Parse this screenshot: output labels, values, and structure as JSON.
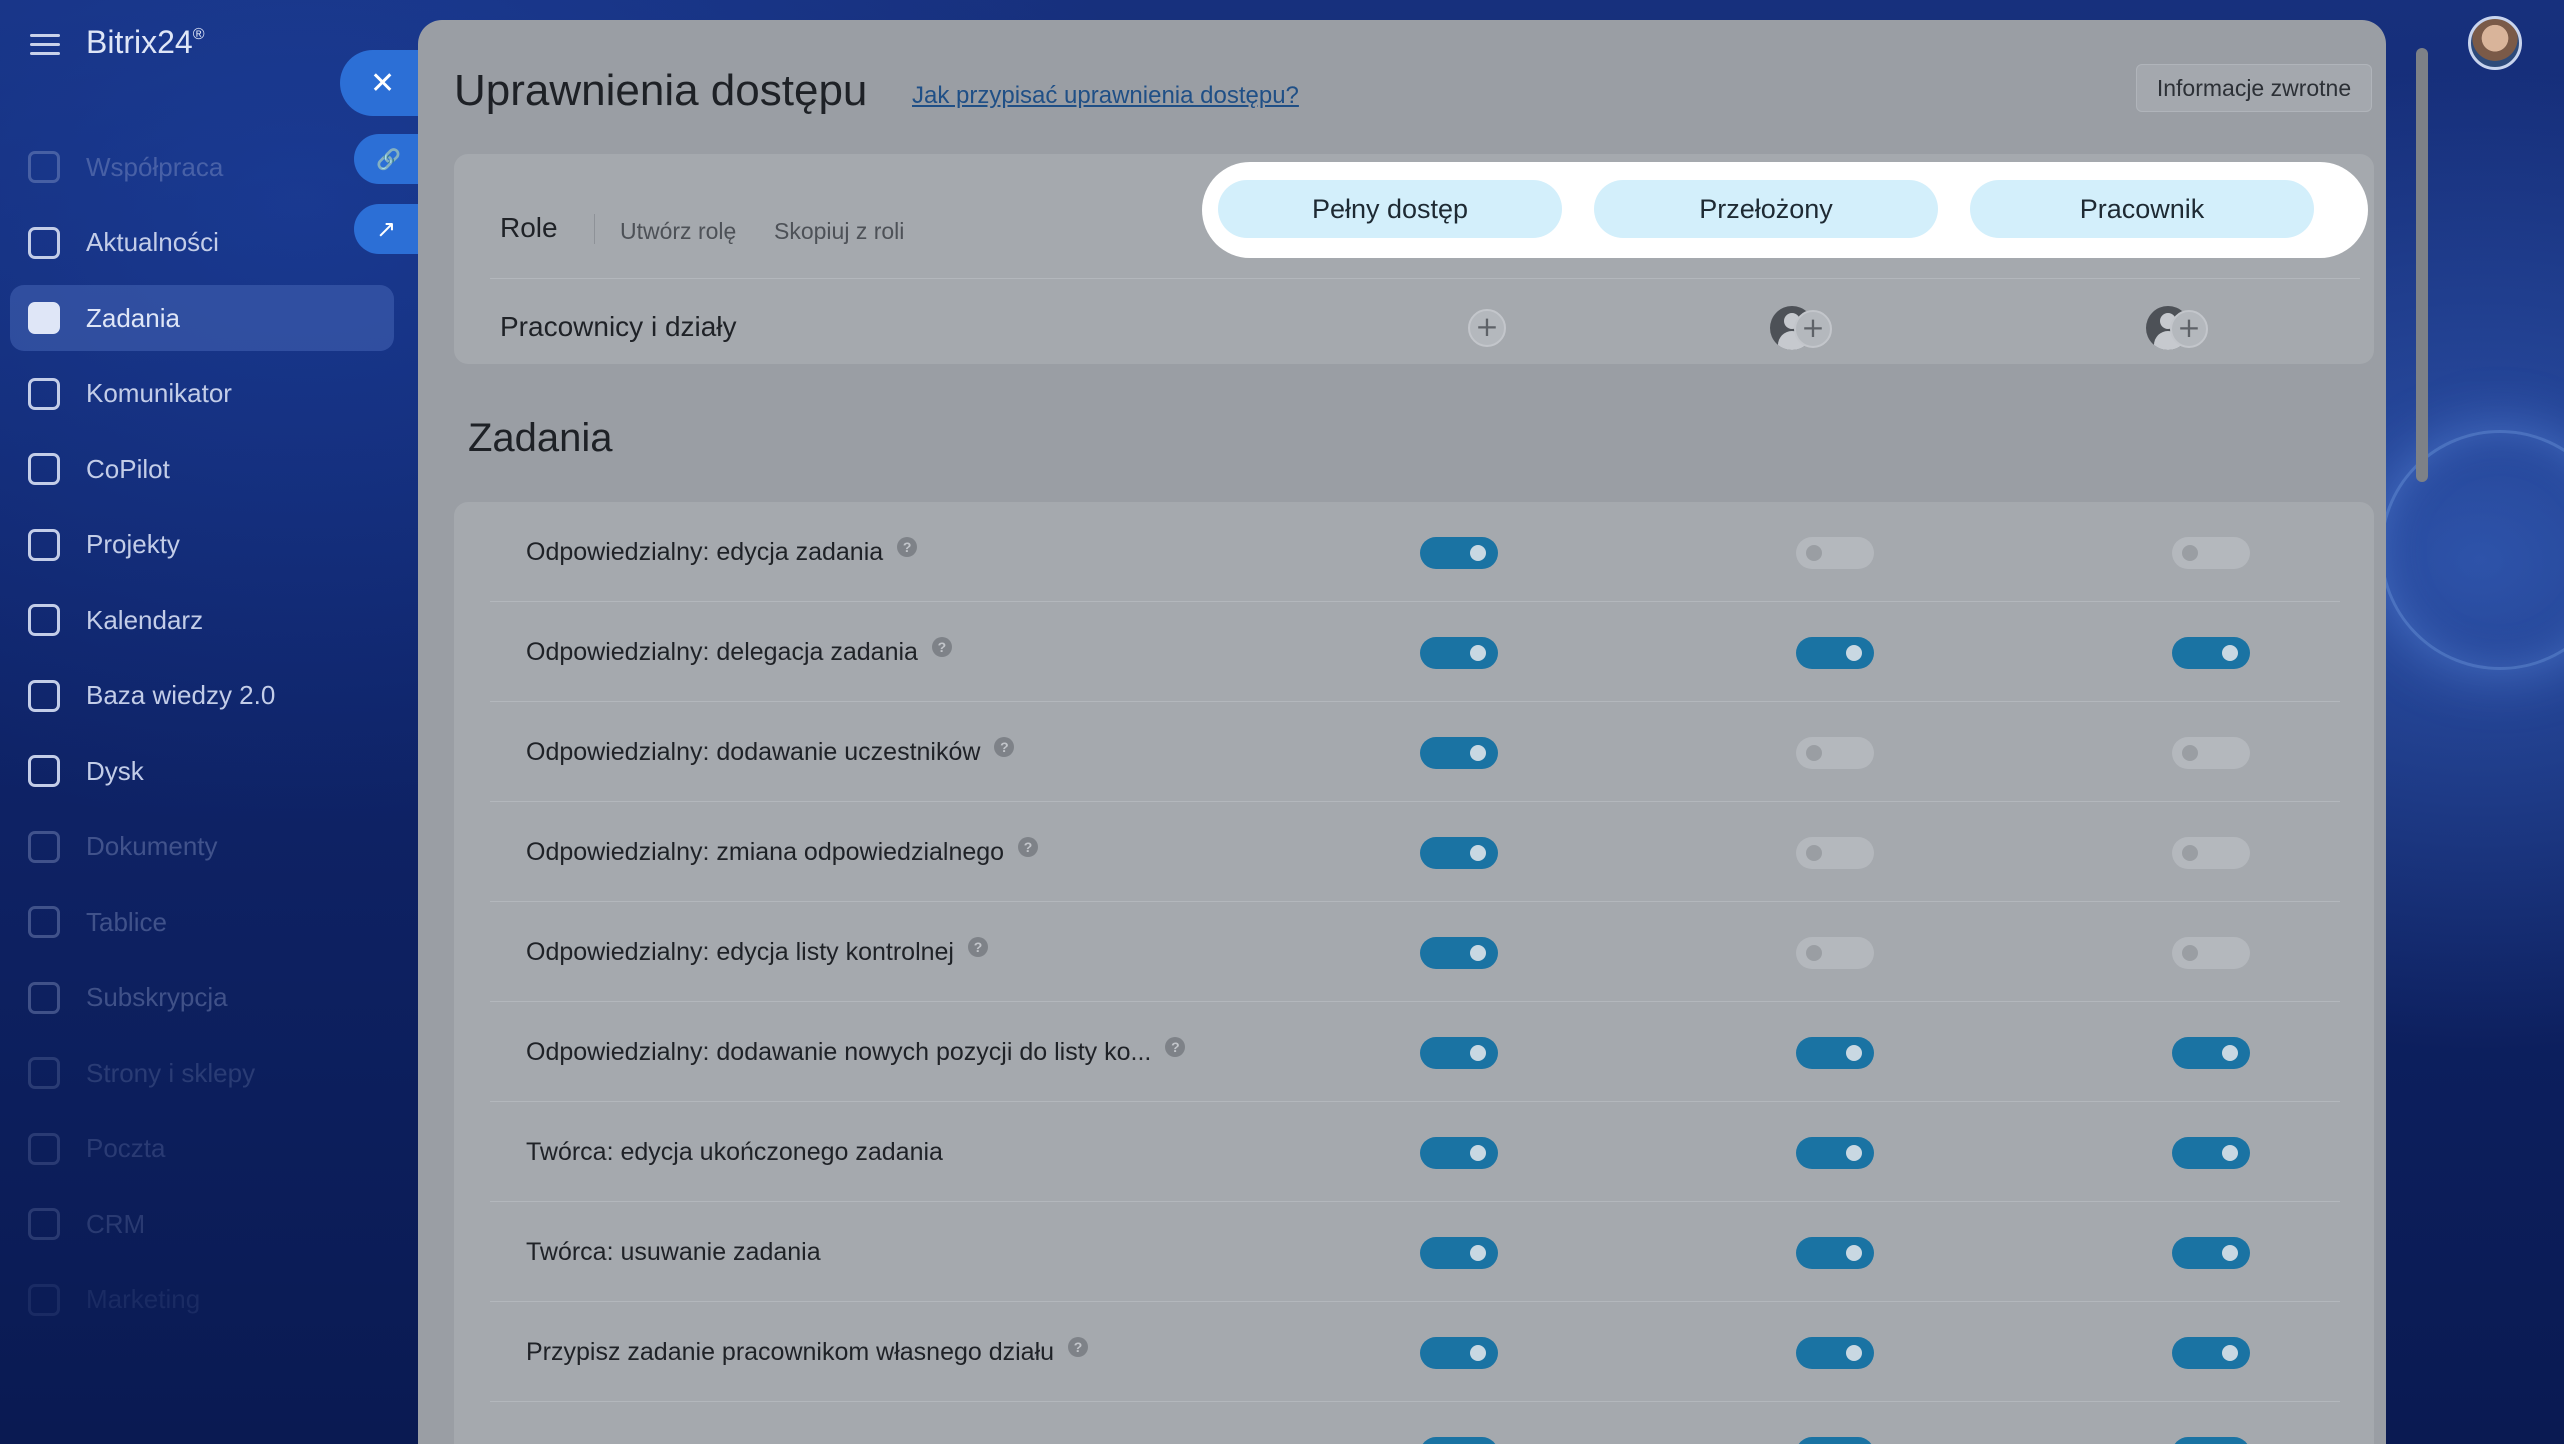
{
  "app": {
    "brand": "Bitrix24",
    "brand_mark": "®"
  },
  "sidebar": {
    "items": [
      {
        "label": "Współpraca",
        "icon": "collaboration-icon",
        "state": "dim"
      },
      {
        "label": "Aktualności",
        "icon": "news-icon",
        "state": "bright"
      },
      {
        "label": "Zadania",
        "icon": "tasks-icon",
        "state": "active"
      },
      {
        "label": "Komunikator",
        "icon": "chat-icon",
        "state": "bright"
      },
      {
        "label": "CoPilot",
        "icon": "copilot-icon",
        "state": "bright"
      },
      {
        "label": "Projekty",
        "icon": "projects-icon",
        "state": "bright"
      },
      {
        "label": "Kalendarz",
        "icon": "calendar-icon",
        "state": "bright"
      },
      {
        "label": "Baza wiedzy 2.0",
        "icon": "knowledge-base-icon",
        "state": "bright"
      },
      {
        "label": "Dysk",
        "icon": "drive-icon",
        "state": "bright"
      },
      {
        "label": "Dokumenty",
        "icon": "documents-icon",
        "state": "dim"
      },
      {
        "label": "Tablice",
        "icon": "boards-icon",
        "state": "dim"
      },
      {
        "label": "Subskrypcja",
        "icon": "subscription-icon",
        "state": "dim"
      },
      {
        "label": "Strony i sklepy",
        "icon": "sites-icon",
        "state": "dimmer"
      },
      {
        "label": "Poczta",
        "icon": "mail-icon",
        "state": "dimmer"
      },
      {
        "label": "CRM",
        "icon": "crm-icon",
        "state": "dimmer"
      },
      {
        "label": "Marketing",
        "icon": "marketing-icon",
        "state": "dimmest"
      }
    ]
  },
  "side_actions": {
    "close": "✕",
    "link": "🔗",
    "open_external": "↗"
  },
  "panel": {
    "title": "Uprawnienia dostępu",
    "help_link": "Jak przypisać uprawnienia dostępu?",
    "feedback": "Informacje zwrotne"
  },
  "roles": {
    "label": "Role",
    "create": "Utwórz rolę",
    "copy": "Skopiuj z roli",
    "columns": [
      "Pełny dostęp",
      "Przełożony",
      "Pracownik"
    ],
    "staff_label": "Pracownicy i działy",
    "add_symbol": "+"
  },
  "section": {
    "title": "Zadania"
  },
  "permissions": [
    {
      "label": "Odpowiedzialny: edycja zadania",
      "help": true,
      "values": [
        true,
        false,
        false
      ]
    },
    {
      "label": "Odpowiedzialny: delegacja zadania",
      "help": true,
      "values": [
        true,
        true,
        true
      ]
    },
    {
      "label": "Odpowiedzialny: dodawanie uczestników",
      "help": true,
      "values": [
        true,
        false,
        false
      ]
    },
    {
      "label": "Odpowiedzialny: zmiana odpowiedzialnego",
      "help": true,
      "values": [
        true,
        false,
        false
      ]
    },
    {
      "label": "Odpowiedzialny: edycja listy kontrolnej",
      "help": true,
      "values": [
        true,
        false,
        false
      ]
    },
    {
      "label": "Odpowiedzialny: dodawanie nowych pozycji do listy ko...",
      "help": true,
      "values": [
        true,
        true,
        true
      ]
    },
    {
      "label": "Twórca: edycja ukończonego zadania",
      "help": false,
      "values": [
        true,
        true,
        true
      ]
    },
    {
      "label": "Twórca: usuwanie zadania",
      "help": false,
      "values": [
        true,
        true,
        true
      ]
    },
    {
      "label": "Przypisz zadanie pracownikom własnego działu",
      "help": true,
      "values": [
        true,
        true,
        true
      ]
    },
    {
      "label": "",
      "help": false,
      "values": [
        true,
        true,
        true
      ]
    }
  ],
  "help_glyph": "?",
  "colors": {
    "toggle_on": "#1a73a3",
    "highlight": "#ffffff",
    "chip": "#d3effb"
  }
}
